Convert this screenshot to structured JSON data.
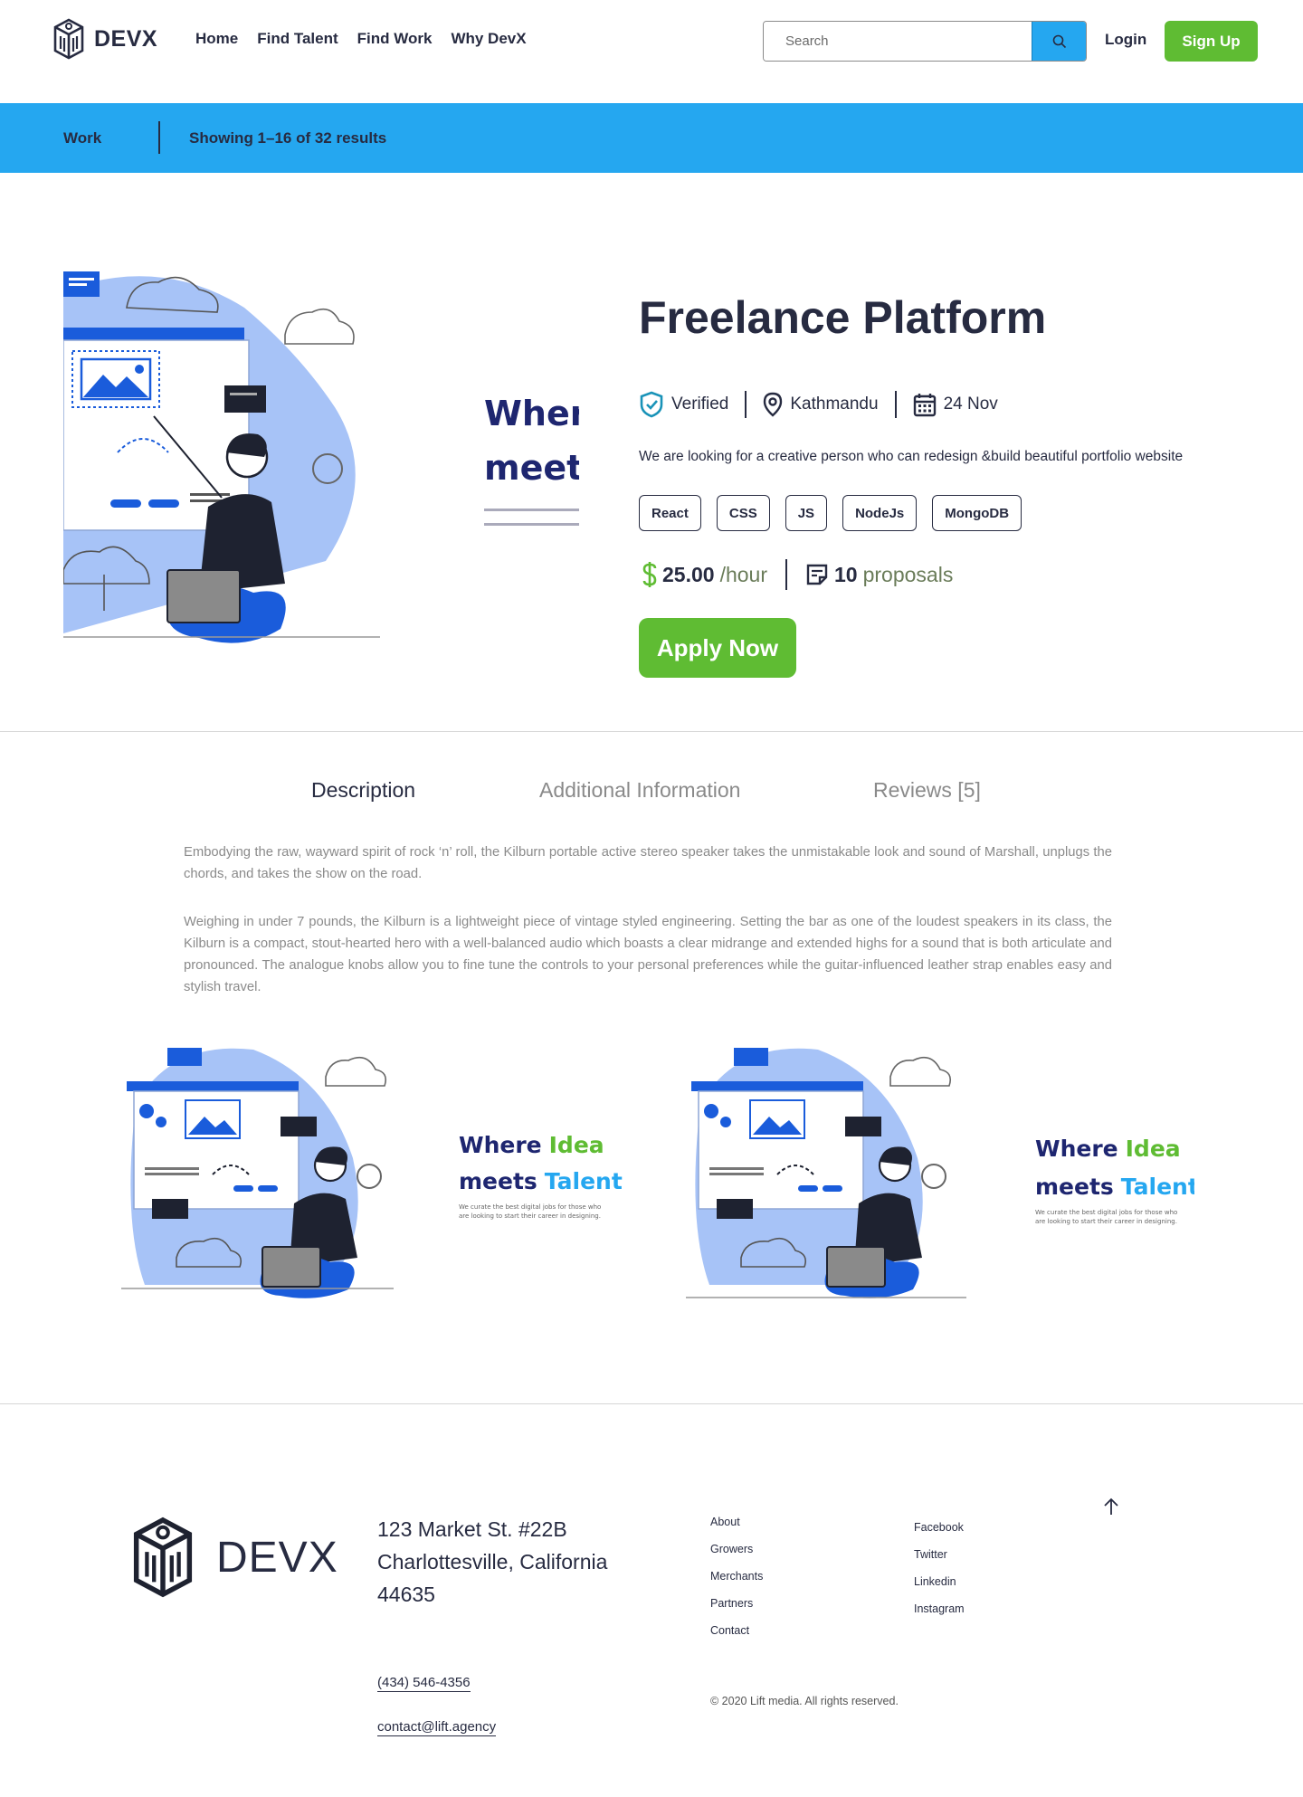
{
  "header": {
    "logo_text": "DEVX",
    "nav": [
      "Home",
      "Find Talent",
      "Find Work",
      "Why DevX"
    ],
    "search_placeholder": "Search",
    "login_label": "Login",
    "signup_label": "Sign Up"
  },
  "breadcrumb": {
    "section": "Work",
    "results": "Showing 1–16 of 32 results"
  },
  "job": {
    "title": "Freelance Platform",
    "verified": "Verified",
    "location": "Kathmandu",
    "date": "24 Nov",
    "description": "We are looking for a creative person who can redesign &build beautiful portfolio website",
    "tags": [
      "React",
      "CSS",
      "JS",
      "NodeJs",
      "MongoDB"
    ],
    "rate_value": "25.00",
    "rate_unit": "/hour",
    "proposals_count": "10",
    "proposals_label": "proposals",
    "apply_label": "Apply Now"
  },
  "banner": {
    "line1_a": "Where",
    "line1_b": "Idea",
    "line2_a": "meets",
    "line2_b": "Talent",
    "small_line1": "We curate the best digital jobs for those who",
    "small_line2": "are looking to start their career in designing."
  },
  "tabs": {
    "description": "Description",
    "additional": "Additional Information",
    "reviews": "Reviews [5]"
  },
  "content": {
    "para1": "Embodying the raw, wayward spirit of rock ‘n’ roll, the Kilburn portable active stereo speaker takes the unmistakable look and sound of Marshall, unplugs the chords, and takes the show on the road.",
    "para2": "Weighing in under 7 pounds, the Kilburn is a lightweight piece of vintage styled engineering. Setting the bar as one of the loudest speakers in its class, the Kilburn is a compact, stout-hearted hero with a well-balanced audio which boasts a clear midrange and extended highs for a sound that is both articulate and pronounced. The analogue knobs allow you to fine tune the controls to your personal preferences while the guitar-influenced leather strap enables easy and stylish travel."
  },
  "footer": {
    "logo_text": "DEVX",
    "address_line1": "123 Market St. #22B",
    "address_line2": "Charlottesville, California",
    "address_line3": "44635",
    "phone": "(434) 546-4356",
    "email": "contact@lift.agency",
    "links_col1": [
      "About",
      "Growers",
      "Merchants",
      "Partners",
      "Contact"
    ],
    "links_col2": [
      "Facebook",
      "Twitter",
      "Linkedin",
      "Instagram"
    ],
    "copyright": "© 2020 Lift media. All rights reserved."
  },
  "colors": {
    "primary_blue": "#25a7f0",
    "green": "#5fbc33",
    "dark": "#272b41",
    "illustration_blue": "#1a5cdb"
  }
}
